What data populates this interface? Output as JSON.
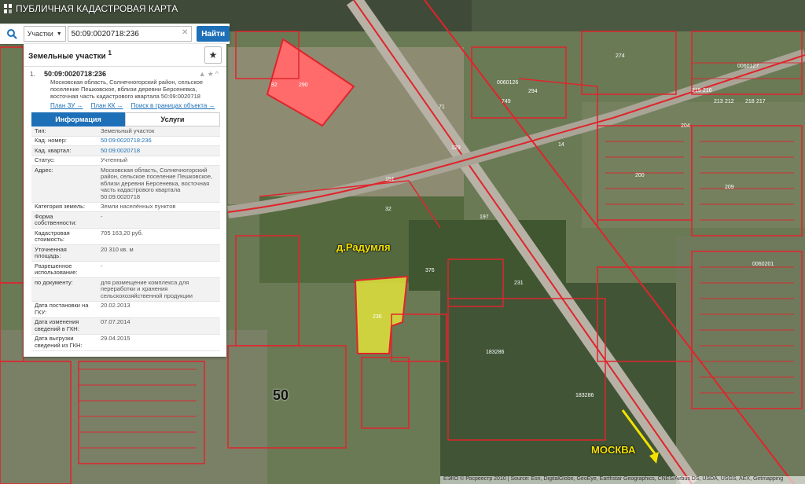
{
  "app": {
    "title": "ПУБЛИЧНАЯ КАДАСТРОВАЯ КАРТА"
  },
  "search": {
    "kind": "Участки",
    "value": "50:09:0020718:236",
    "button": "Найти"
  },
  "panel": {
    "title": "Земельные участки",
    "title_sup": "1",
    "entry": {
      "number": "1.",
      "cad_number": "50:09:0020718:236",
      "address": "Московская область, Солнечногорский район, сельское поселение Пешковское, вблизи деревни Берсеневка, восточная часть кадастрового квартала 50:09:0020718",
      "links": [
        "План ЗУ →",
        "План КК →",
        "Поиск в границах объекта →"
      ]
    },
    "tabs": [
      "Информация",
      "Услуги"
    ],
    "rows": [
      {
        "k": "Тип:",
        "v": "Земельный участок"
      },
      {
        "k": "Кад. номер:",
        "v": "50:09:0020718:236",
        "link": true
      },
      {
        "k": "Кад. квартал:",
        "v": "50:09:0020718",
        "link": true
      },
      {
        "k": "Статус:",
        "v": "Учтенный"
      },
      {
        "k": "Адрес:",
        "v": "Московская область, Солнечногорский район, сельское поселение Пешковское, вблизи деревни Берсеневка, восточная часть кадастрового квартала 50:09:0020718"
      },
      {
        "k": "Категория земель:",
        "v": "Земли населённых пунктов"
      },
      {
        "k": "Форма собственности:",
        "v": "-"
      },
      {
        "k": "Кадастровая стоимость:",
        "v": "705 163,20 руб."
      },
      {
        "k": "Уточненная площадь:",
        "v": "20 310 кв. м"
      },
      {
        "k": "Разрешенное использование:",
        "v": "-"
      },
      {
        "k": "по документу:",
        "v": "для размещение комплекса для переработки и хранения сельскохозяйственной продукции"
      },
      {
        "k": "Дата постановки на ГКУ:",
        "v": "20.02.2013"
      },
      {
        "k": "Дата изменения сведений в ГКН:",
        "v": "07.07.2014"
      },
      {
        "k": "Дата выгрузки сведений из ГКН:",
        "v": "29.04.2015"
      }
    ]
  },
  "map": {
    "place_label": "д.Радумля",
    "direction_label": "МОСКВА",
    "district_label": "50",
    "parcel_labels": [
      "290",
      "82",
      "274",
      "294",
      "749",
      "129",
      "151",
      "32",
      "197",
      "376",
      "231",
      "236",
      "183286",
      "183286",
      "14",
      "71",
      "200",
      "209",
      "204",
      "213",
      "212",
      "215",
      "216",
      "218",
      "217"
    ],
    "quarter_labels": [
      "0060126",
      "0060127",
      "0060201"
    ],
    "attribution": "ЕЭКО © Росреестр 2010 | Source: Esri, DigitalGlobe, GeoEye, Earthstar Geographics, CNES/Airbus DS, USDA, USGS, AEX, Getmapping"
  },
  "colors": {
    "accent": "#1d6fb8",
    "parcel_line": "#e0242c",
    "selected_fill": "#f2f22c",
    "label_yellow": "#f4e200"
  }
}
